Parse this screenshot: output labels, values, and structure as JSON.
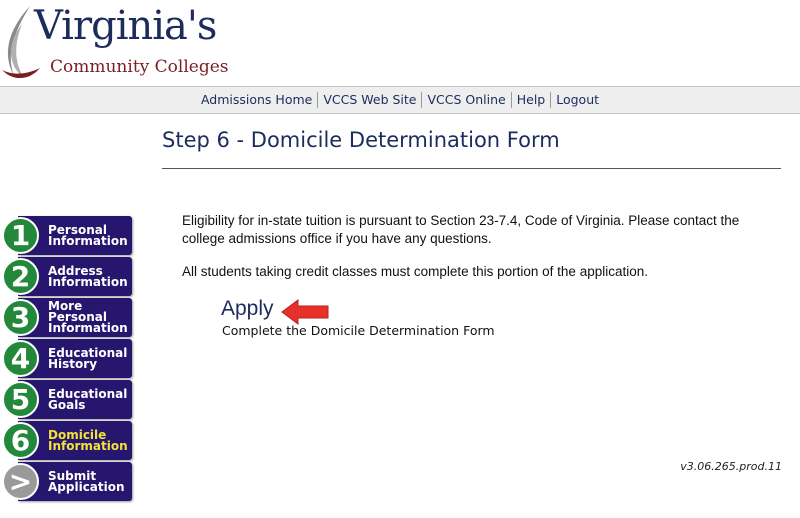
{
  "logo": {
    "title": "Virginia's",
    "subtitle": "Community Colleges"
  },
  "nav": [
    "Admissions Home",
    "VCCS Web Site",
    "VCCS Online",
    "Help",
    "Logout"
  ],
  "page_title": "Step 6 - Domicile Determination Form",
  "paragraph1": "Eligibility for in-state tuition is pursuant to Section 23-7.4, Code of Virginia. Please contact the college admissions office if you have any questions.",
  "paragraph2": "All students taking credit classes must complete this portion of the application.",
  "apply": {
    "label": "Apply",
    "description": "Complete the Domicile Determination Form"
  },
  "version": "v3.06.265.prod.11",
  "steps": [
    {
      "number": "1",
      "label": "Personal Information"
    },
    {
      "number": "2",
      "label": "Address Information"
    },
    {
      "number": "3",
      "label": "More Personal Information"
    },
    {
      "number": "4",
      "label": "Educational History"
    },
    {
      "number": "5",
      "label": "Educational Goals"
    },
    {
      "number": "6",
      "label": "Domicile Information"
    },
    {
      "number": ">",
      "label": "Submit Application"
    }
  ],
  "active_step": 6,
  "colors": {
    "navy": "#1c2c5c",
    "step_tab": "#27166e",
    "step_circle": "#23883a",
    "active_label": "#f4e23a",
    "arrow": "#e8302a"
  }
}
